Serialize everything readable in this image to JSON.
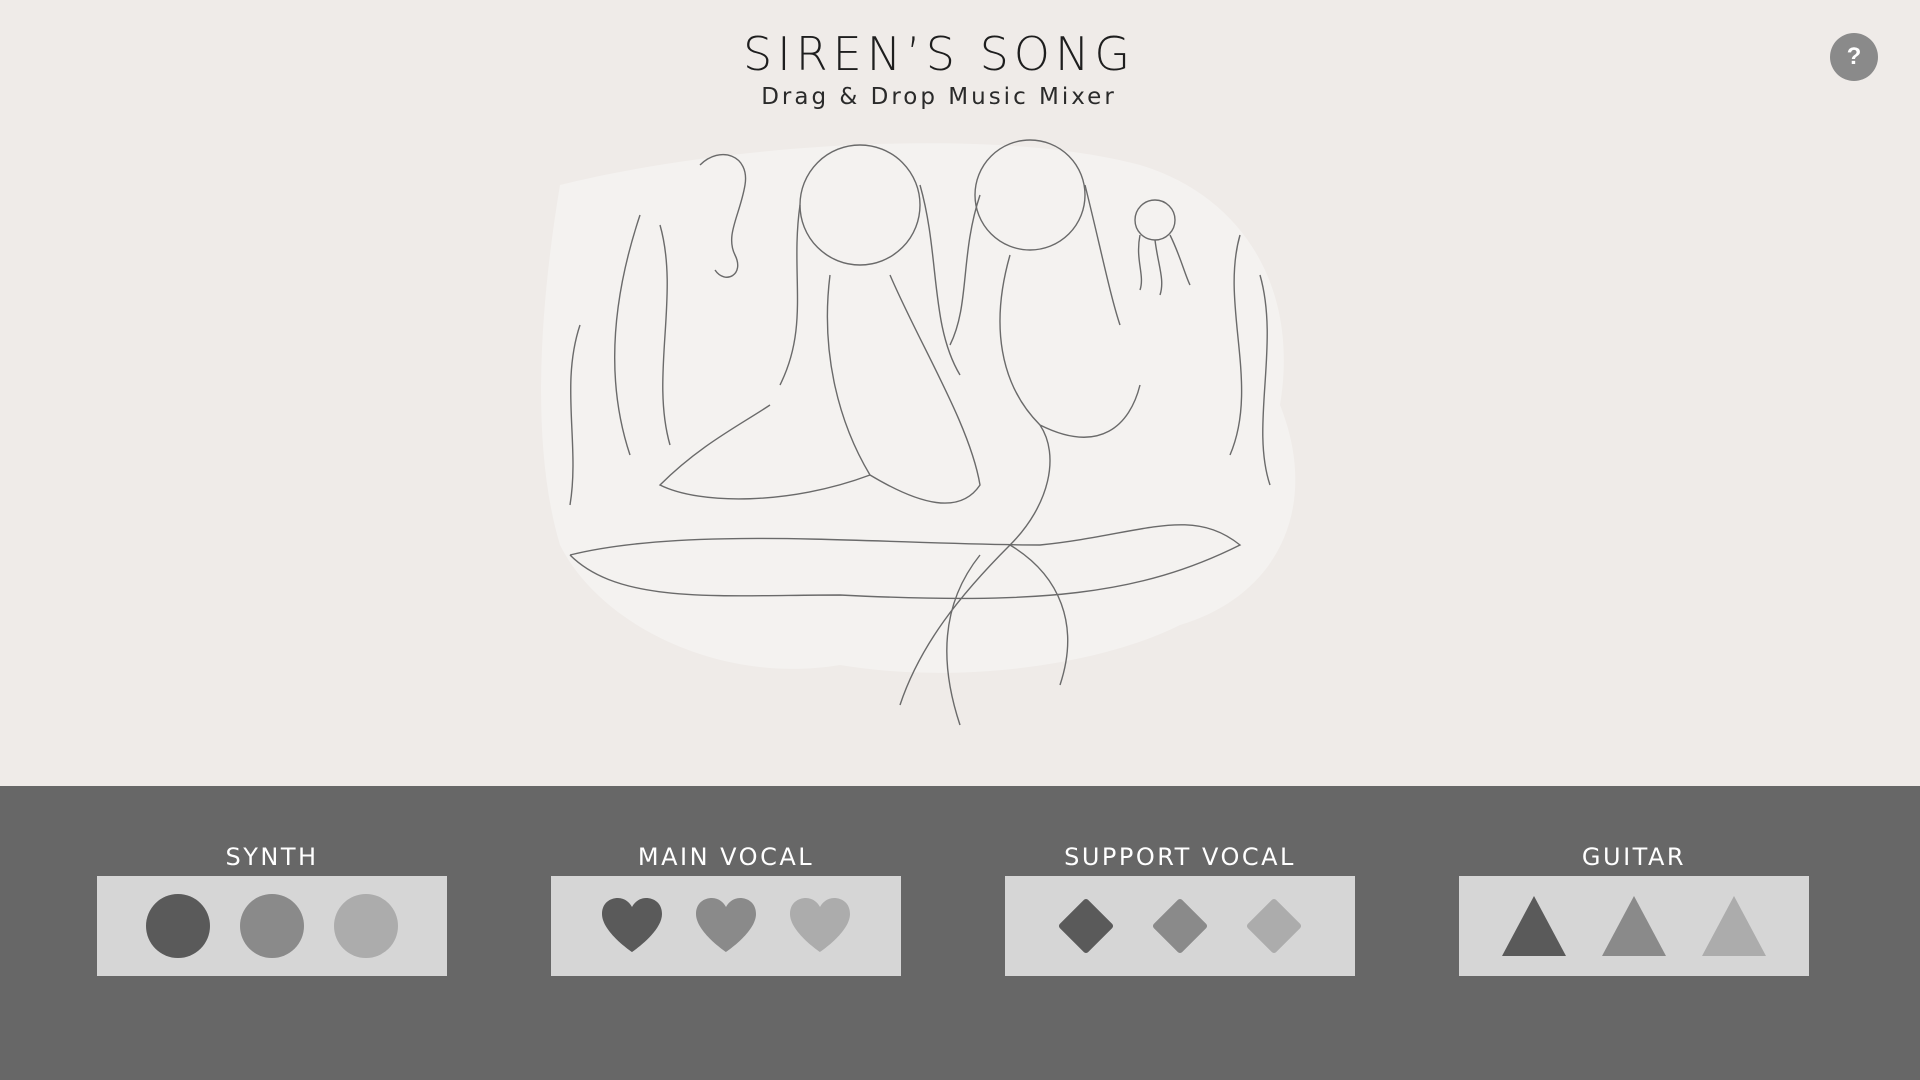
{
  "header": {
    "title": "SIREN’S SONG",
    "subtitle": "Drag & Drop Music Mixer",
    "help_label": "?"
  },
  "illustration": {
    "icon": "mermaids-sketch"
  },
  "colors": {
    "background": "#efebe8",
    "mixer_panel": "#676767",
    "track_box": "#d6d6d6",
    "shade_dark": "#5a5a5a",
    "shade_mid": "#8a8a8a",
    "shade_light": "#acacac"
  },
  "tracks": [
    {
      "label": "SYNTH",
      "shape": "circle"
    },
    {
      "label": "MAIN VOCAL",
      "shape": "heart"
    },
    {
      "label": "SUPPORT VOCAL",
      "shape": "diamond"
    },
    {
      "label": "GUITAR",
      "shape": "triangle"
    }
  ]
}
